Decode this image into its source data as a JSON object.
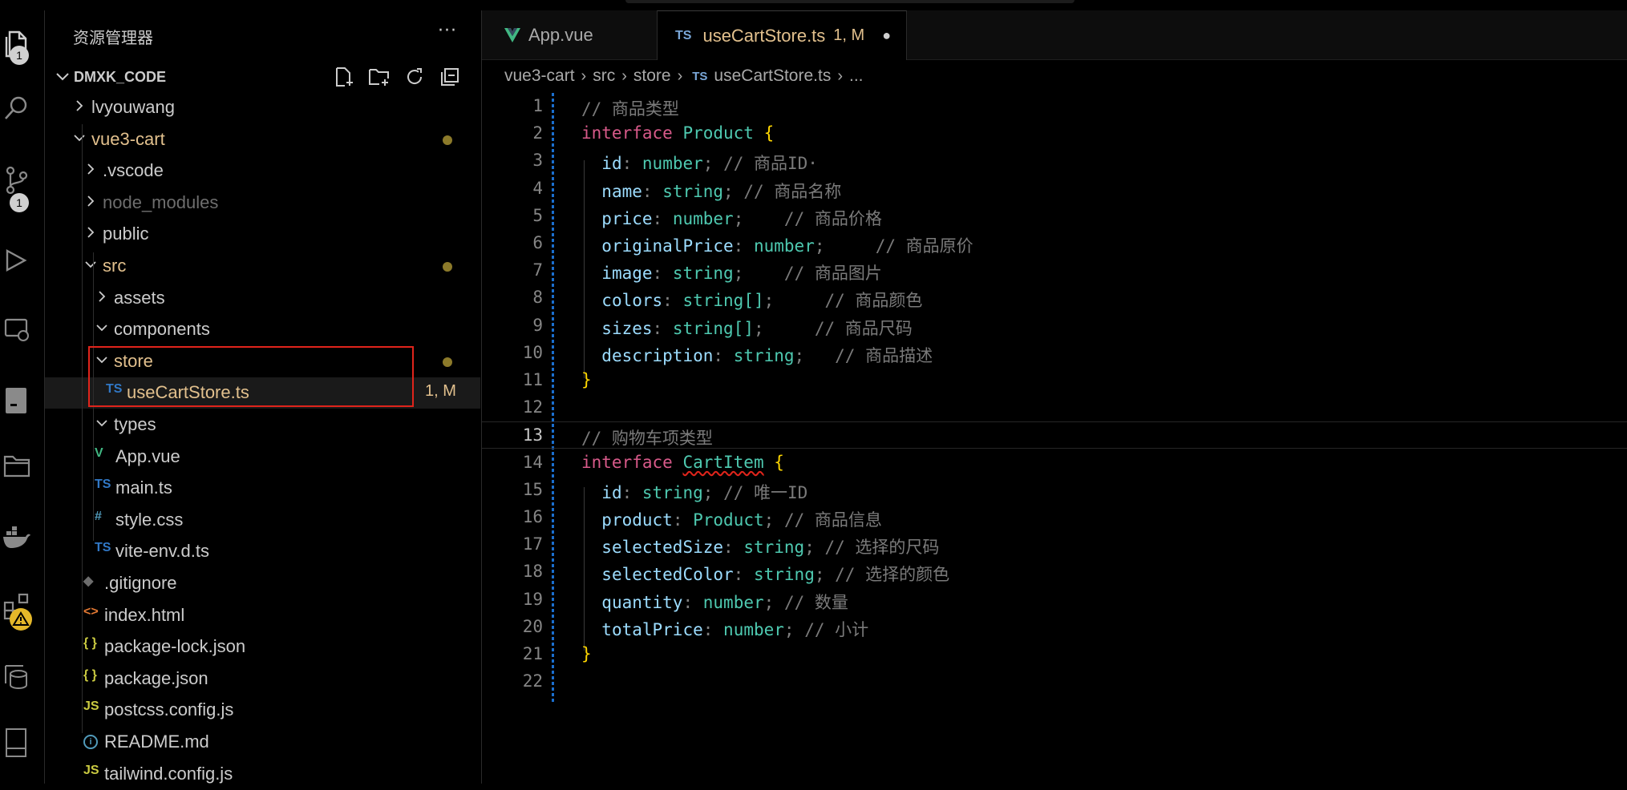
{
  "activity_bar": {
    "explorer_badge": "1",
    "scm_badge": "1",
    "icons": [
      "files-icon",
      "search-icon",
      "source-control-icon",
      "run-debug-icon",
      "remote-explorer-icon",
      "terminal-icon",
      "folder-icon",
      "docker-icon",
      "extensions-icon",
      "database-icon",
      "panel-icon"
    ]
  },
  "sidebar": {
    "title": "资源管理器",
    "more": "···",
    "section": "DMXK_CODE",
    "tree": [
      {
        "label": "lvyouwang",
        "kind": "folder",
        "open": false,
        "depth": 0
      },
      {
        "label": "vue3-cart",
        "kind": "folder",
        "open": true,
        "depth": 0,
        "modified": true
      },
      {
        "label": ".vscode",
        "kind": "folder",
        "open": false,
        "depth": 1
      },
      {
        "label": "node_modules",
        "kind": "folder",
        "open": false,
        "depth": 1,
        "dim": true
      },
      {
        "label": "public",
        "kind": "folder",
        "open": false,
        "depth": 1
      },
      {
        "label": "src",
        "kind": "folder",
        "open": true,
        "depth": 1,
        "modified": true
      },
      {
        "label": "assets",
        "kind": "folder",
        "open": false,
        "depth": 2
      },
      {
        "label": "components",
        "kind": "folder",
        "open": true,
        "depth": 2
      },
      {
        "label": "store",
        "kind": "folder",
        "open": true,
        "depth": 2,
        "modified": true
      },
      {
        "label": "useCartStore.ts",
        "kind": "ts",
        "depth": 3,
        "status": "1, M",
        "selected": true
      },
      {
        "label": "types",
        "kind": "folder",
        "open": true,
        "depth": 2
      },
      {
        "label": "App.vue",
        "kind": "vue",
        "depth": 2
      },
      {
        "label": "main.ts",
        "kind": "ts",
        "depth": 2
      },
      {
        "label": "style.css",
        "kind": "css",
        "depth": 2
      },
      {
        "label": "vite-env.d.ts",
        "kind": "ts",
        "depth": 2
      },
      {
        "label": ".gitignore",
        "kind": "git",
        "depth": 1
      },
      {
        "label": "index.html",
        "kind": "html",
        "depth": 1
      },
      {
        "label": "package-lock.json",
        "kind": "json",
        "depth": 1
      },
      {
        "label": "package.json",
        "kind": "json",
        "depth": 1
      },
      {
        "label": "postcss.config.js",
        "kind": "js",
        "depth": 1
      },
      {
        "label": "README.md",
        "kind": "info",
        "depth": 1
      },
      {
        "label": "tailwind.config.js",
        "kind": "js",
        "depth": 1
      }
    ],
    "file_badges": {
      "ts": "TS",
      "js": "JS",
      "json": "{ }",
      "css": "#",
      "vue": "V",
      "html": "<>",
      "info": "i",
      "git": "◆"
    }
  },
  "editor": {
    "tabs": [
      {
        "label": "App.vue",
        "icon": "vue"
      },
      {
        "label": "useCartStore.ts",
        "status": "1, M",
        "icon": "ts",
        "active": true,
        "dirty_marker": "●"
      }
    ],
    "breadcrumb": [
      "vue3-cart",
      "src",
      "store",
      "useCartStore.ts",
      "..."
    ],
    "breadcrumb_file_badge": "TS",
    "current_line": 13,
    "lines": [
      "// 商品类型",
      "interface Product {",
      "  id: number; // 商品ID·",
      "  name: string; // 商品名称",
      "  price: number;    // 商品价格",
      "  originalPrice: number;     // 商品原价",
      "  image: string;    // 商品图片",
      "  colors: string[];     // 商品颜色",
      "  sizes: string[];     // 商品尺码",
      "  description: string;   // 商品描述",
      "}",
      "",
      "// 购物车项类型",
      "interface CartItem {",
      "  id: string; // 唯一ID",
      "  product: Product; // 商品信息",
      "  selectedSize: string; // 选择的尺码",
      "  selectedColor: string; // 选择的颜色",
      "  quantity: number; // 数量",
      "  totalPrice: number; // 小计",
      "}",
      ""
    ]
  },
  "colors": {
    "keyword": "#d85a8a",
    "type": "#4ec9b0",
    "property": "#9cdcfe",
    "comment": "#7a7a7a",
    "bracket": "#ffd700",
    "modified": "#e2c08d",
    "folder_open": "#e2c08d",
    "ts": "#3178c6",
    "js": "#cbcb41",
    "vue": "#41b883",
    "highlight_box": "#e0241b"
  }
}
